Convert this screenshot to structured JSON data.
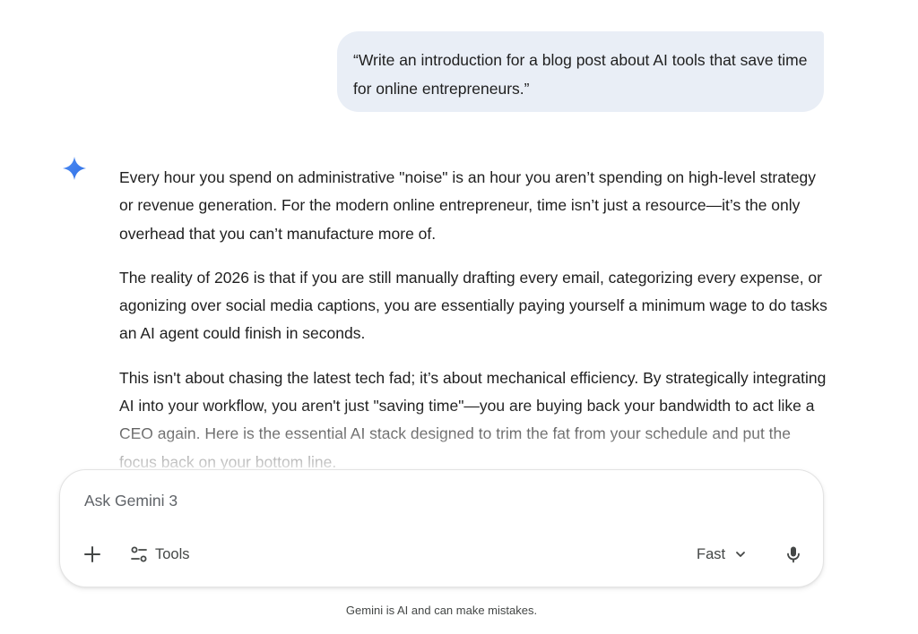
{
  "user_message": {
    "text": "“Write an introduction for a blog post about AI tools that save time for online entrepreneurs.”"
  },
  "response": {
    "icon": "gemini-sparkle-icon",
    "paragraphs": [
      "Every hour you spend on administrative \"noise\" is an hour you aren’t spending on high-level strategy or revenue generation. For the modern online entrepreneur, time isn’t just a resource—it’s the only overhead that you can’t manufacture more of.",
      "The reality of 2026 is that if you are still manually drafting every email, categorizing every expense, or agonizing over social media captions, you are essentially paying yourself a minimum wage to do tasks an AI agent could finish in seconds.",
      "This isn't about chasing the latest tech fad; it’s about mechanical efficiency. By strategically integrating AI into your workflow, you aren't just \"saving time\"—you are buying back your bandwidth to act like a CEO again. Here is the essential AI stack designed to trim the fat from your schedule and put the focus back on your bottom line."
    ]
  },
  "input": {
    "placeholder": "Ask Gemini 3",
    "tools_label": "Tools",
    "model_label": "Fast",
    "icons": {
      "add": "plus-icon",
      "tools": "tools-icon",
      "dropdown": "chevron-down-icon",
      "mic": "microphone-icon"
    }
  },
  "footer": {
    "disclaimer": "Gemini is AI and can make mistakes."
  },
  "colors": {
    "bubble": "#e9eef6",
    "text": "#1f1f1f",
    "muted": "#444746",
    "gemini_blue": "#4285f4"
  }
}
